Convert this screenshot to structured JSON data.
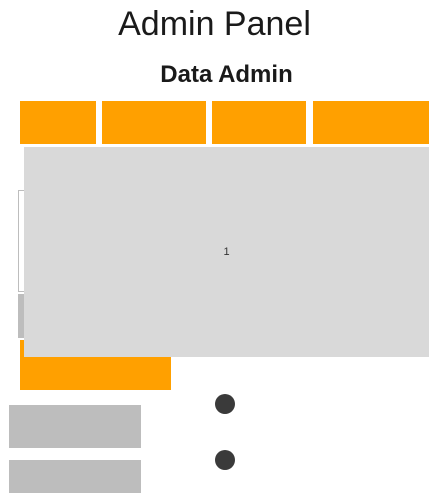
{
  "header": {
    "title": "Admin Panel",
    "subtitle": "Data Admin"
  },
  "tabs": [
    {
      "label": ""
    },
    {
      "label": ""
    },
    {
      "label": ""
    },
    {
      "label": ""
    }
  ],
  "overlay": {
    "text": "1"
  },
  "colors": {
    "accent": "#ffa000",
    "overlay": "#d9d9d9",
    "block": "#bdbdbd",
    "dot": "#3a3a3a"
  }
}
